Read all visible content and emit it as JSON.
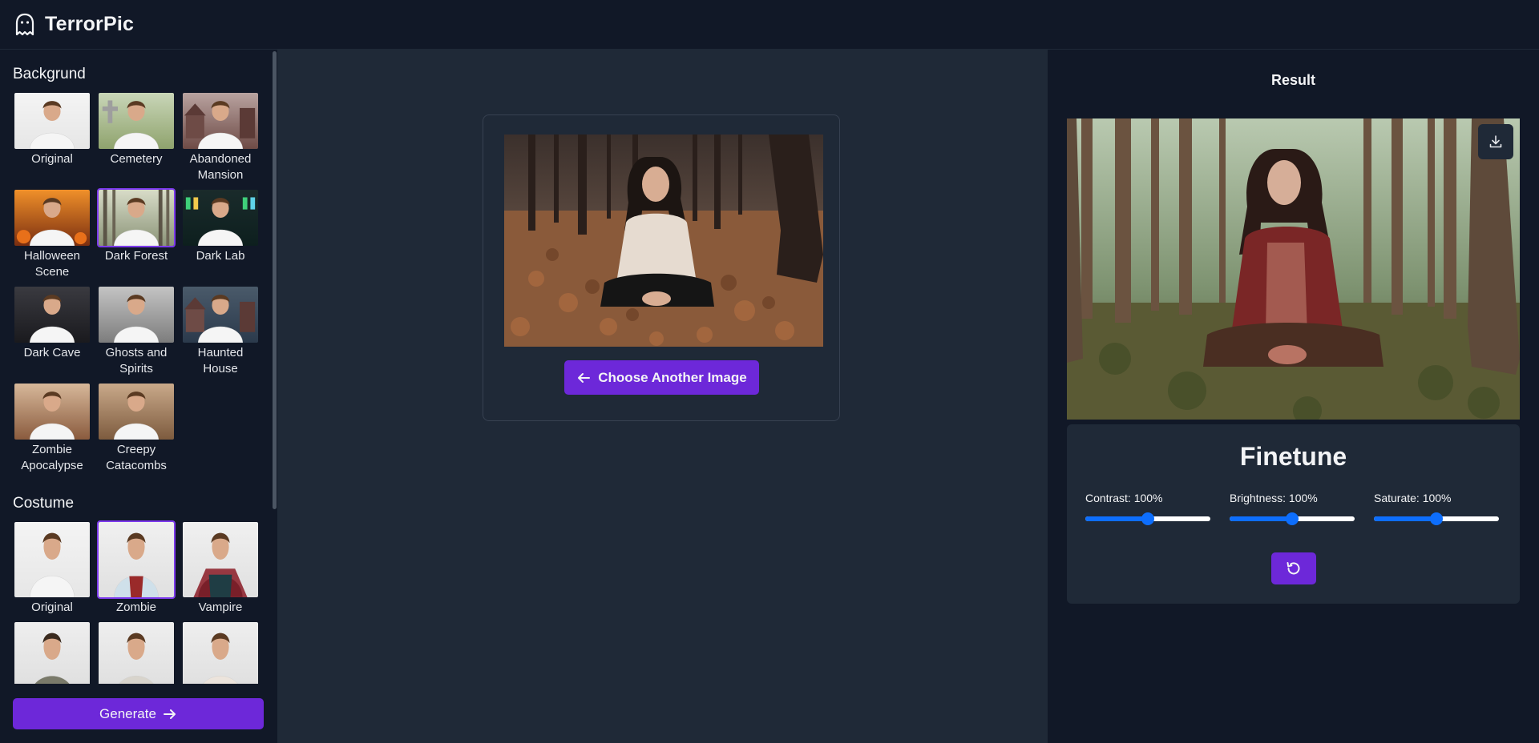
{
  "app": {
    "title": "TerrorPic"
  },
  "sidebar": {
    "background_title": "Backgrund",
    "backgrounds": [
      {
        "label": "Original",
        "theme": "white",
        "selected": false
      },
      {
        "label": "Cemetery",
        "theme": "cemetery",
        "selected": false
      },
      {
        "label": "Abandoned Mansion",
        "theme": "mansion",
        "selected": false
      },
      {
        "label": "Halloween Scene",
        "theme": "halloween",
        "selected": false
      },
      {
        "label": "Dark Forest",
        "theme": "forest",
        "selected": true
      },
      {
        "label": "Dark Lab",
        "theme": "lab",
        "selected": false
      },
      {
        "label": "Dark Cave",
        "theme": "cave",
        "selected": false
      },
      {
        "label": "Ghosts and Spirits",
        "theme": "ghosts",
        "selected": false
      },
      {
        "label": "Haunted House",
        "theme": "haunted",
        "selected": false
      },
      {
        "label": "Zombie Apocalypse",
        "theme": "apocalypse",
        "selected": false
      },
      {
        "label": "Creepy Catacombs",
        "theme": "catacombs",
        "selected": false
      }
    ],
    "costume_title": "Costume",
    "costumes": [
      {
        "label": "Original",
        "theme": "white",
        "selected": false
      },
      {
        "label": "Zombie",
        "theme": "zombie",
        "selected": true
      },
      {
        "label": "Vampire",
        "theme": "vampire",
        "selected": false
      },
      {
        "label": "",
        "theme": "woman",
        "selected": false
      },
      {
        "label": "",
        "theme": "mummy",
        "selected": false
      },
      {
        "label": "",
        "theme": "skeleton",
        "selected": false
      }
    ],
    "generate_label": "Generate"
  },
  "upload": {
    "choose_label": "Choose Another Image"
  },
  "result": {
    "title": "Result",
    "finetune": {
      "title": "Finetune",
      "sliders": [
        {
          "name": "Contrast",
          "label": "Contrast: 100%",
          "value": 100,
          "min": 0,
          "max": 200
        },
        {
          "name": "Brightness",
          "label": "Brightness: 100%",
          "value": 100,
          "min": 0,
          "max": 200
        },
        {
          "name": "Saturate",
          "label": "Saturate: 100%",
          "value": 100,
          "min": 0,
          "max": 200
        }
      ]
    }
  },
  "icons": {
    "logo": "ghost-icon",
    "generate": "arrow-right-icon",
    "choose": "arrow-left-icon",
    "download": "download-icon",
    "reset": "rotate-ccw-icon"
  },
  "colors": {
    "accent": "#6d28d9",
    "slider": "#0d6efd",
    "sidebar_bg": "#111827",
    "main_bg": "#1f2937"
  }
}
